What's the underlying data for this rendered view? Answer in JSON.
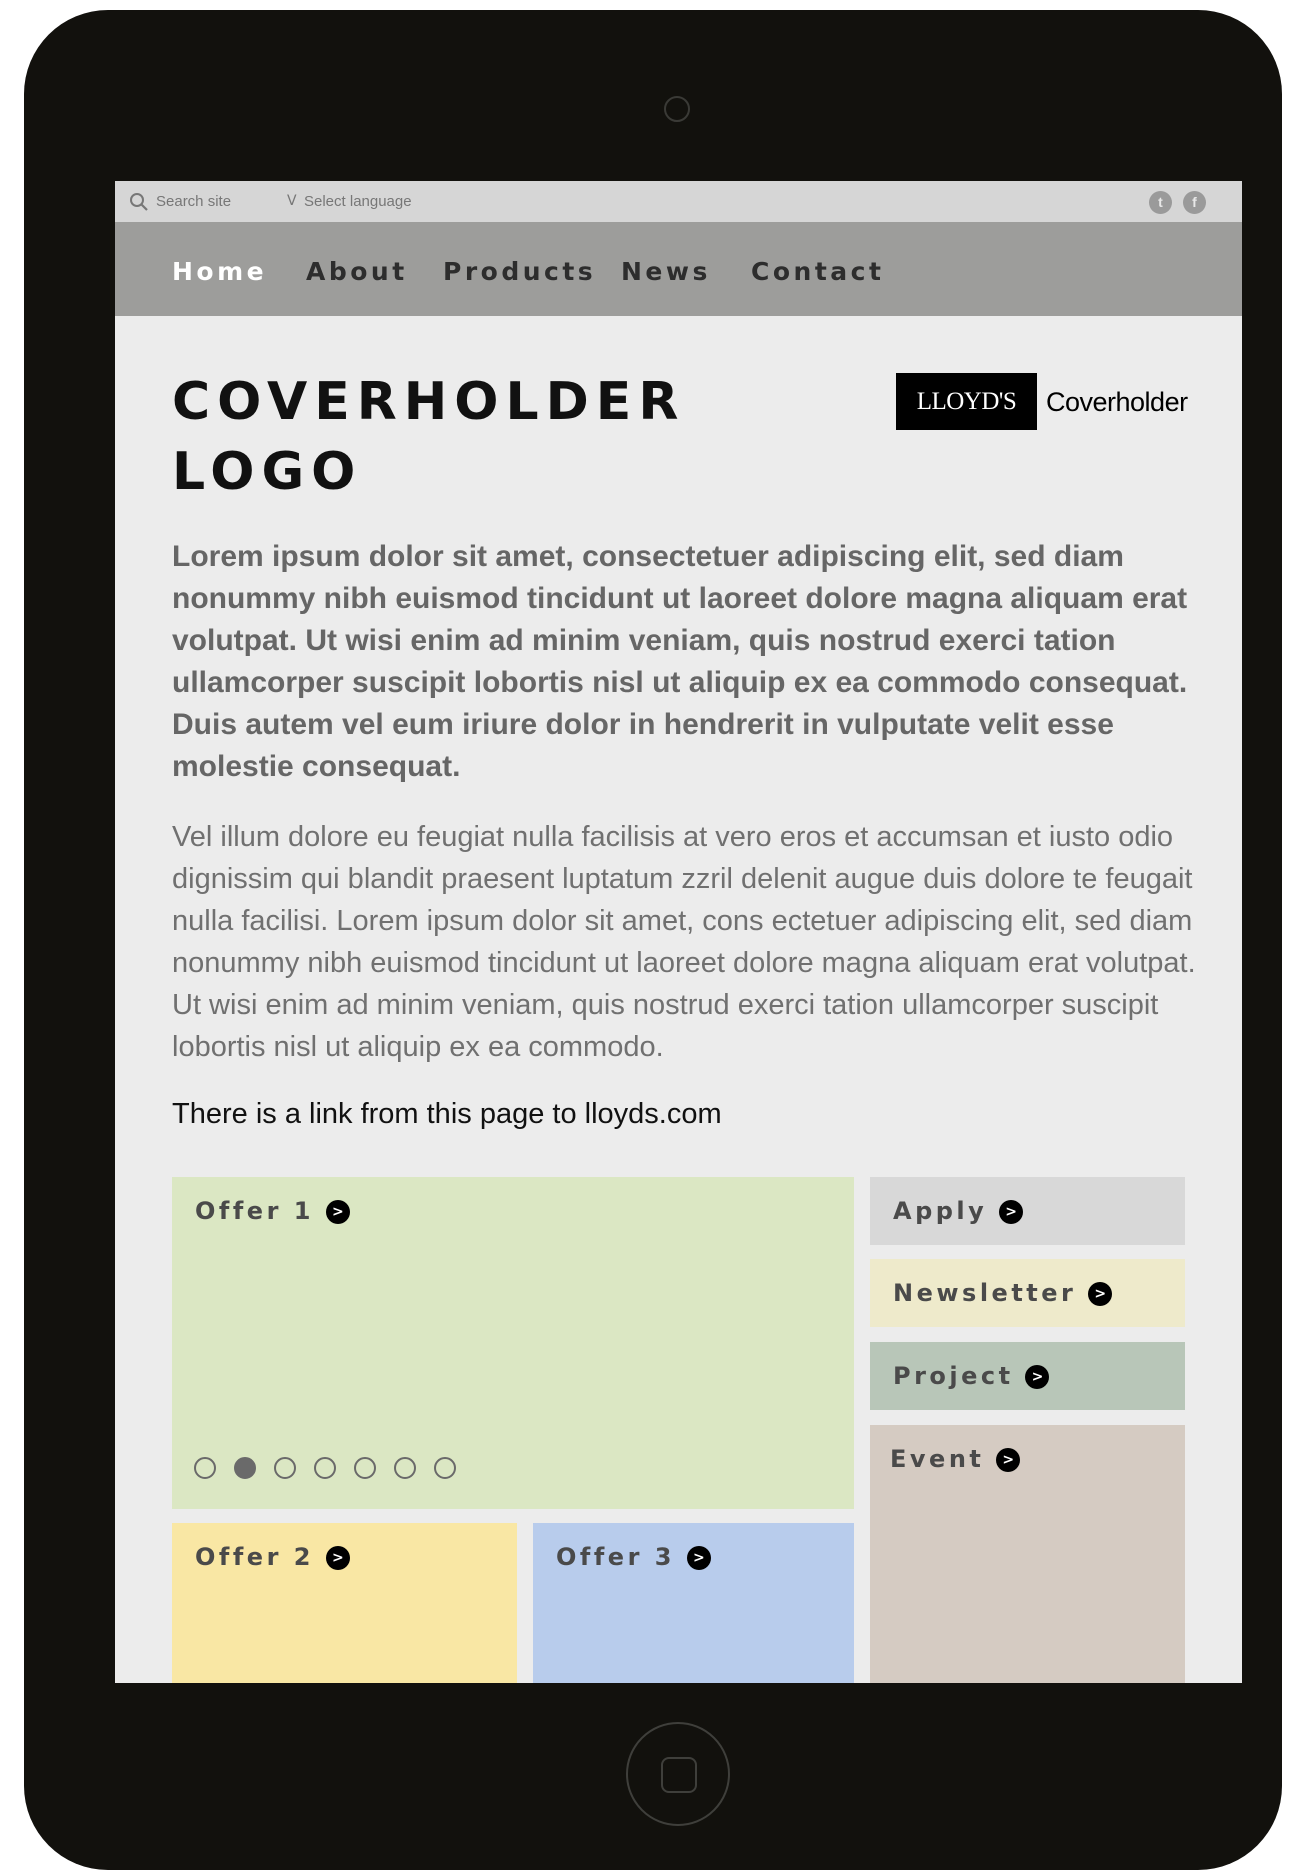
{
  "utility_bar": {
    "search_label": "Search site",
    "language_chevron": "V",
    "language_label": "Select language",
    "social": [
      {
        "icon": "twitter-icon",
        "glyph": "t"
      },
      {
        "icon": "facebook-icon",
        "glyph": "f"
      }
    ]
  },
  "nav": {
    "items": [
      {
        "label": "Home",
        "active": true
      },
      {
        "label": "About",
        "active": false
      },
      {
        "label": "Products",
        "active": false
      },
      {
        "label": "News",
        "active": false
      },
      {
        "label": "Contact",
        "active": false
      }
    ]
  },
  "header": {
    "logo_line1": "COVERHOLDER",
    "logo_line2": "LOGO",
    "lloyds_mark": "LLOYD'S",
    "lloyds_coverholder": "Coverholder"
  },
  "content": {
    "lead": "Lorem ipsum dolor sit amet, consectetuer adipiscing elit, sed diam nonummy nibh euismod tincidunt ut laoreet dolore magna aliquam erat volutpat. Ut wisi enim ad minim veniam, quis nostrud exerci tation ullamcorper suscipit lobortis nisl ut aliquip ex ea commodo consequat. Duis autem vel eum iriure dolor in hendrerit in vulputate velit esse molestie consequat.",
    "body": "Vel illum dolore eu feugiat nulla facilisis at vero eros et accumsan et iusto odio dignissim qui blandit praesent luptatum zzril delenit augue duis dolore te feugait nulla facilisi. Lorem ipsum dolor sit amet, cons ectetuer adipiscing elit, sed diam nonummy nibh euismod tincidunt ut laoreet dolore magna aliquam erat volutpat. Ut wisi enim ad minim veniam, quis nostrud exerci tation ullamcorper suscipit lobortis nisl ut aliquip ex ea commodo.",
    "link_note": "There is a link from this page to lloyds.com"
  },
  "tiles": {
    "arrow_glyph": ">",
    "offer1": {
      "label": "Offer 1",
      "color": "#dbe7c3"
    },
    "offer2": {
      "label": "Offer 2",
      "color": "#f9e7a4"
    },
    "offer3": {
      "label": "Offer 3",
      "color": "#b8ccec"
    },
    "apply": {
      "label": "Apply",
      "color": "#d8d8d8"
    },
    "newsletter": {
      "label": "Newsletter",
      "color": "#eeeacb"
    },
    "project": {
      "label": "Project",
      "color": "#b8c6b8"
    },
    "event": {
      "label": "Event",
      "color": "#d5cbc2"
    }
  },
  "carousel": {
    "count": 7,
    "active_index": 1
  }
}
